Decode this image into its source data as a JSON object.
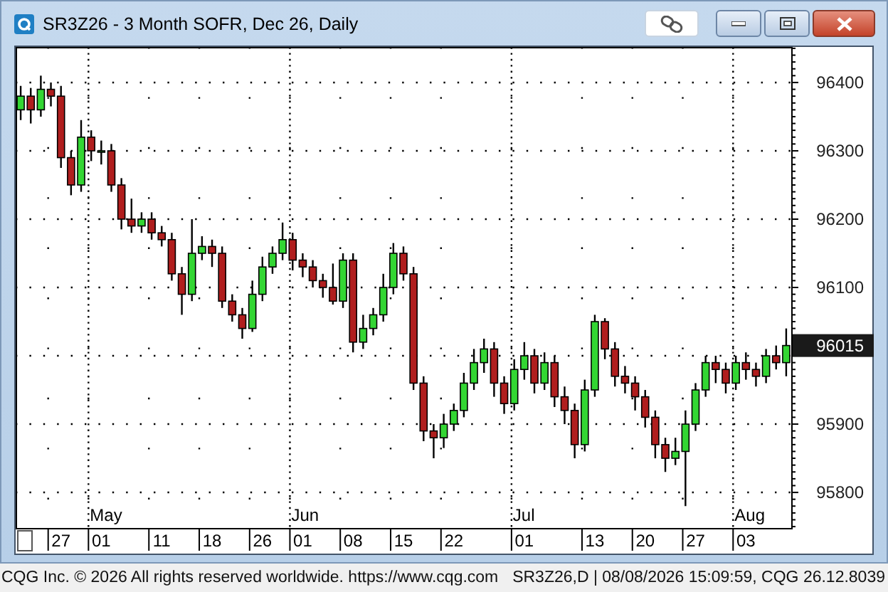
{
  "window": {
    "title": "SR3Z26 - 3 Month SOFR, Dec 26, Daily"
  },
  "chart": {
    "last_price": "96015",
    "chart_data": {
      "type": "candlestick",
      "grid": true,
      "ylim": [
        95748,
        96452
      ],
      "yticks": [
        95800,
        95900,
        96100,
        96200,
        96300,
        96400
      ],
      "categories": [
        null,
        null,
        null,
        null,
        "27",
        null,
        null,
        null,
        "01",
        null,
        null,
        null,
        null,
        null,
        "11",
        null,
        null,
        null,
        null,
        "18",
        null,
        null,
        null,
        null,
        "26",
        null,
        null,
        null,
        "01",
        null,
        null,
        null,
        null,
        "08",
        null,
        null,
        null,
        null,
        "15",
        null,
        null,
        null,
        null,
        "22",
        null,
        null,
        null,
        null,
        null,
        null,
        "01",
        null,
        null,
        null,
        null,
        null,
        null,
        "13",
        null,
        null,
        null,
        null,
        "20",
        null,
        null,
        null,
        null,
        "27",
        null,
        null,
        null,
        null,
        "03",
        null,
        null,
        null,
        null
      ],
      "annotations": [
        "May",
        "Jun",
        "Jul",
        "Aug"
      ],
      "ohlc": [
        [
          96360,
          96395,
          96345,
          96380
        ],
        [
          96380,
          96392,
          96340,
          96360
        ],
        [
          96360,
          96410,
          96350,
          96390
        ],
        [
          96390,
          96400,
          96365,
          96380
        ],
        [
          96380,
          96395,
          96275,
          96290
        ],
        [
          96290,
          96300,
          96235,
          96250
        ],
        [
          96250,
          96345,
          96240,
          96320
        ],
        [
          96320,
          96330,
          96285,
          96300
        ],
        [
          96300,
          96315,
          96280,
          96300
        ],
        [
          96300,
          96310,
          96240,
          96250
        ],
        [
          96250,
          96260,
          96185,
          96200
        ],
        [
          96200,
          96230,
          96180,
          96190
        ],
        [
          96190,
          96210,
          96180,
          96200
        ],
        [
          96200,
          96210,
          96170,
          96180
        ],
        [
          96180,
          96190,
          96160,
          96170
        ],
        [
          96170,
          96180,
          96110,
          96120
        ],
        [
          96120,
          96130,
          96060,
          96090
        ],
        [
          96090,
          96200,
          96080,
          96150
        ],
        [
          96150,
          96175,
          96140,
          96160
        ],
        [
          96160,
          96170,
          96130,
          96150
        ],
        [
          96150,
          96160,
          96070,
          96080
        ],
        [
          96080,
          96090,
          96050,
          96060
        ],
        [
          96060,
          96070,
          96025,
          96040
        ],
        [
          96040,
          96110,
          96035,
          96090
        ],
        [
          96090,
          96145,
          96080,
          96130
        ],
        [
          96130,
          96160,
          96120,
          96150
        ],
        [
          96150,
          96195,
          96140,
          96170
        ],
        [
          96170,
          96180,
          96125,
          96140
        ],
        [
          96140,
          96150,
          96115,
          96130
        ],
        [
          96130,
          96140,
          96100,
          96110
        ],
        [
          96110,
          96120,
          96085,
          96100
        ],
        [
          96100,
          96135,
          96075,
          96080
        ],
        [
          96080,
          96150,
          96070,
          96140
        ],
        [
          96140,
          96150,
          96005,
          96020
        ],
        [
          96020,
          96060,
          96010,
          96040
        ],
        [
          96040,
          96070,
          96030,
          96060
        ],
        [
          96060,
          96120,
          96050,
          96100
        ],
        [
          96100,
          96165,
          96090,
          96150
        ],
        [
          96150,
          96160,
          96110,
          96120
        ],
        [
          96120,
          96130,
          95950,
          95960
        ],
        [
          95960,
          95970,
          95875,
          95890
        ],
        [
          95890,
          95900,
          95850,
          95880
        ],
        [
          95880,
          95915,
          95865,
          95900
        ],
        [
          95900,
          95930,
          95890,
          95920
        ],
        [
          95920,
          95975,
          95910,
          95960
        ],
        [
          95960,
          96010,
          95950,
          95990
        ],
        [
          95990,
          96025,
          95975,
          96010
        ],
        [
          96010,
          96020,
          95940,
          95960
        ],
        [
          95960,
          95970,
          95915,
          95930
        ],
        [
          95930,
          95995,
          95920,
          95980
        ],
        [
          95980,
          96020,
          95965,
          96000
        ],
        [
          96000,
          96010,
          95945,
          95960
        ],
        [
          95960,
          96005,
          95950,
          95990
        ],
        [
          95990,
          96000,
          95925,
          95940
        ],
        [
          95940,
          95955,
          95900,
          95920
        ],
        [
          95920,
          95930,
          95850,
          95870
        ],
        [
          95870,
          95965,
          95860,
          95950
        ],
        [
          95950,
          96060,
          95940,
          96050
        ],
        [
          96050,
          96055,
          95995,
          96010
        ],
        [
          96010,
          96020,
          95955,
          95970
        ],
        [
          95970,
          95985,
          95945,
          95960
        ],
        [
          95960,
          95970,
          95920,
          95940
        ],
        [
          95940,
          95950,
          95895,
          95910
        ],
        [
          95910,
          95920,
          95850,
          95870
        ],
        [
          95870,
          95880,
          95830,
          95850
        ],
        [
          95850,
          95880,
          95840,
          95860
        ],
        [
          95860,
          95920,
          95780,
          95900
        ],
        [
          95900,
          95960,
          95890,
          95950
        ],
        [
          95950,
          96000,
          95940,
          95990
        ],
        [
          95990,
          96000,
          95960,
          95980
        ],
        [
          95980,
          95990,
          95945,
          95960
        ],
        [
          95960,
          96000,
          95950,
          95990
        ],
        [
          95990,
          96005,
          95965,
          95980
        ],
        [
          95980,
          95990,
          95955,
          95970
        ],
        [
          95970,
          96010,
          95960,
          96000
        ],
        [
          96000,
          96015,
          95980,
          95990
        ],
        [
          95990,
          96040,
          95970,
          96015
        ]
      ]
    }
  },
  "status_bar": {
    "left": "CQG Inc. © 2026 All rights reserved worldwide. https://www.cqg.com",
    "right": "SR3Z26,D | 08/08/2026 15:09:59, CQG 26.12.8039"
  }
}
